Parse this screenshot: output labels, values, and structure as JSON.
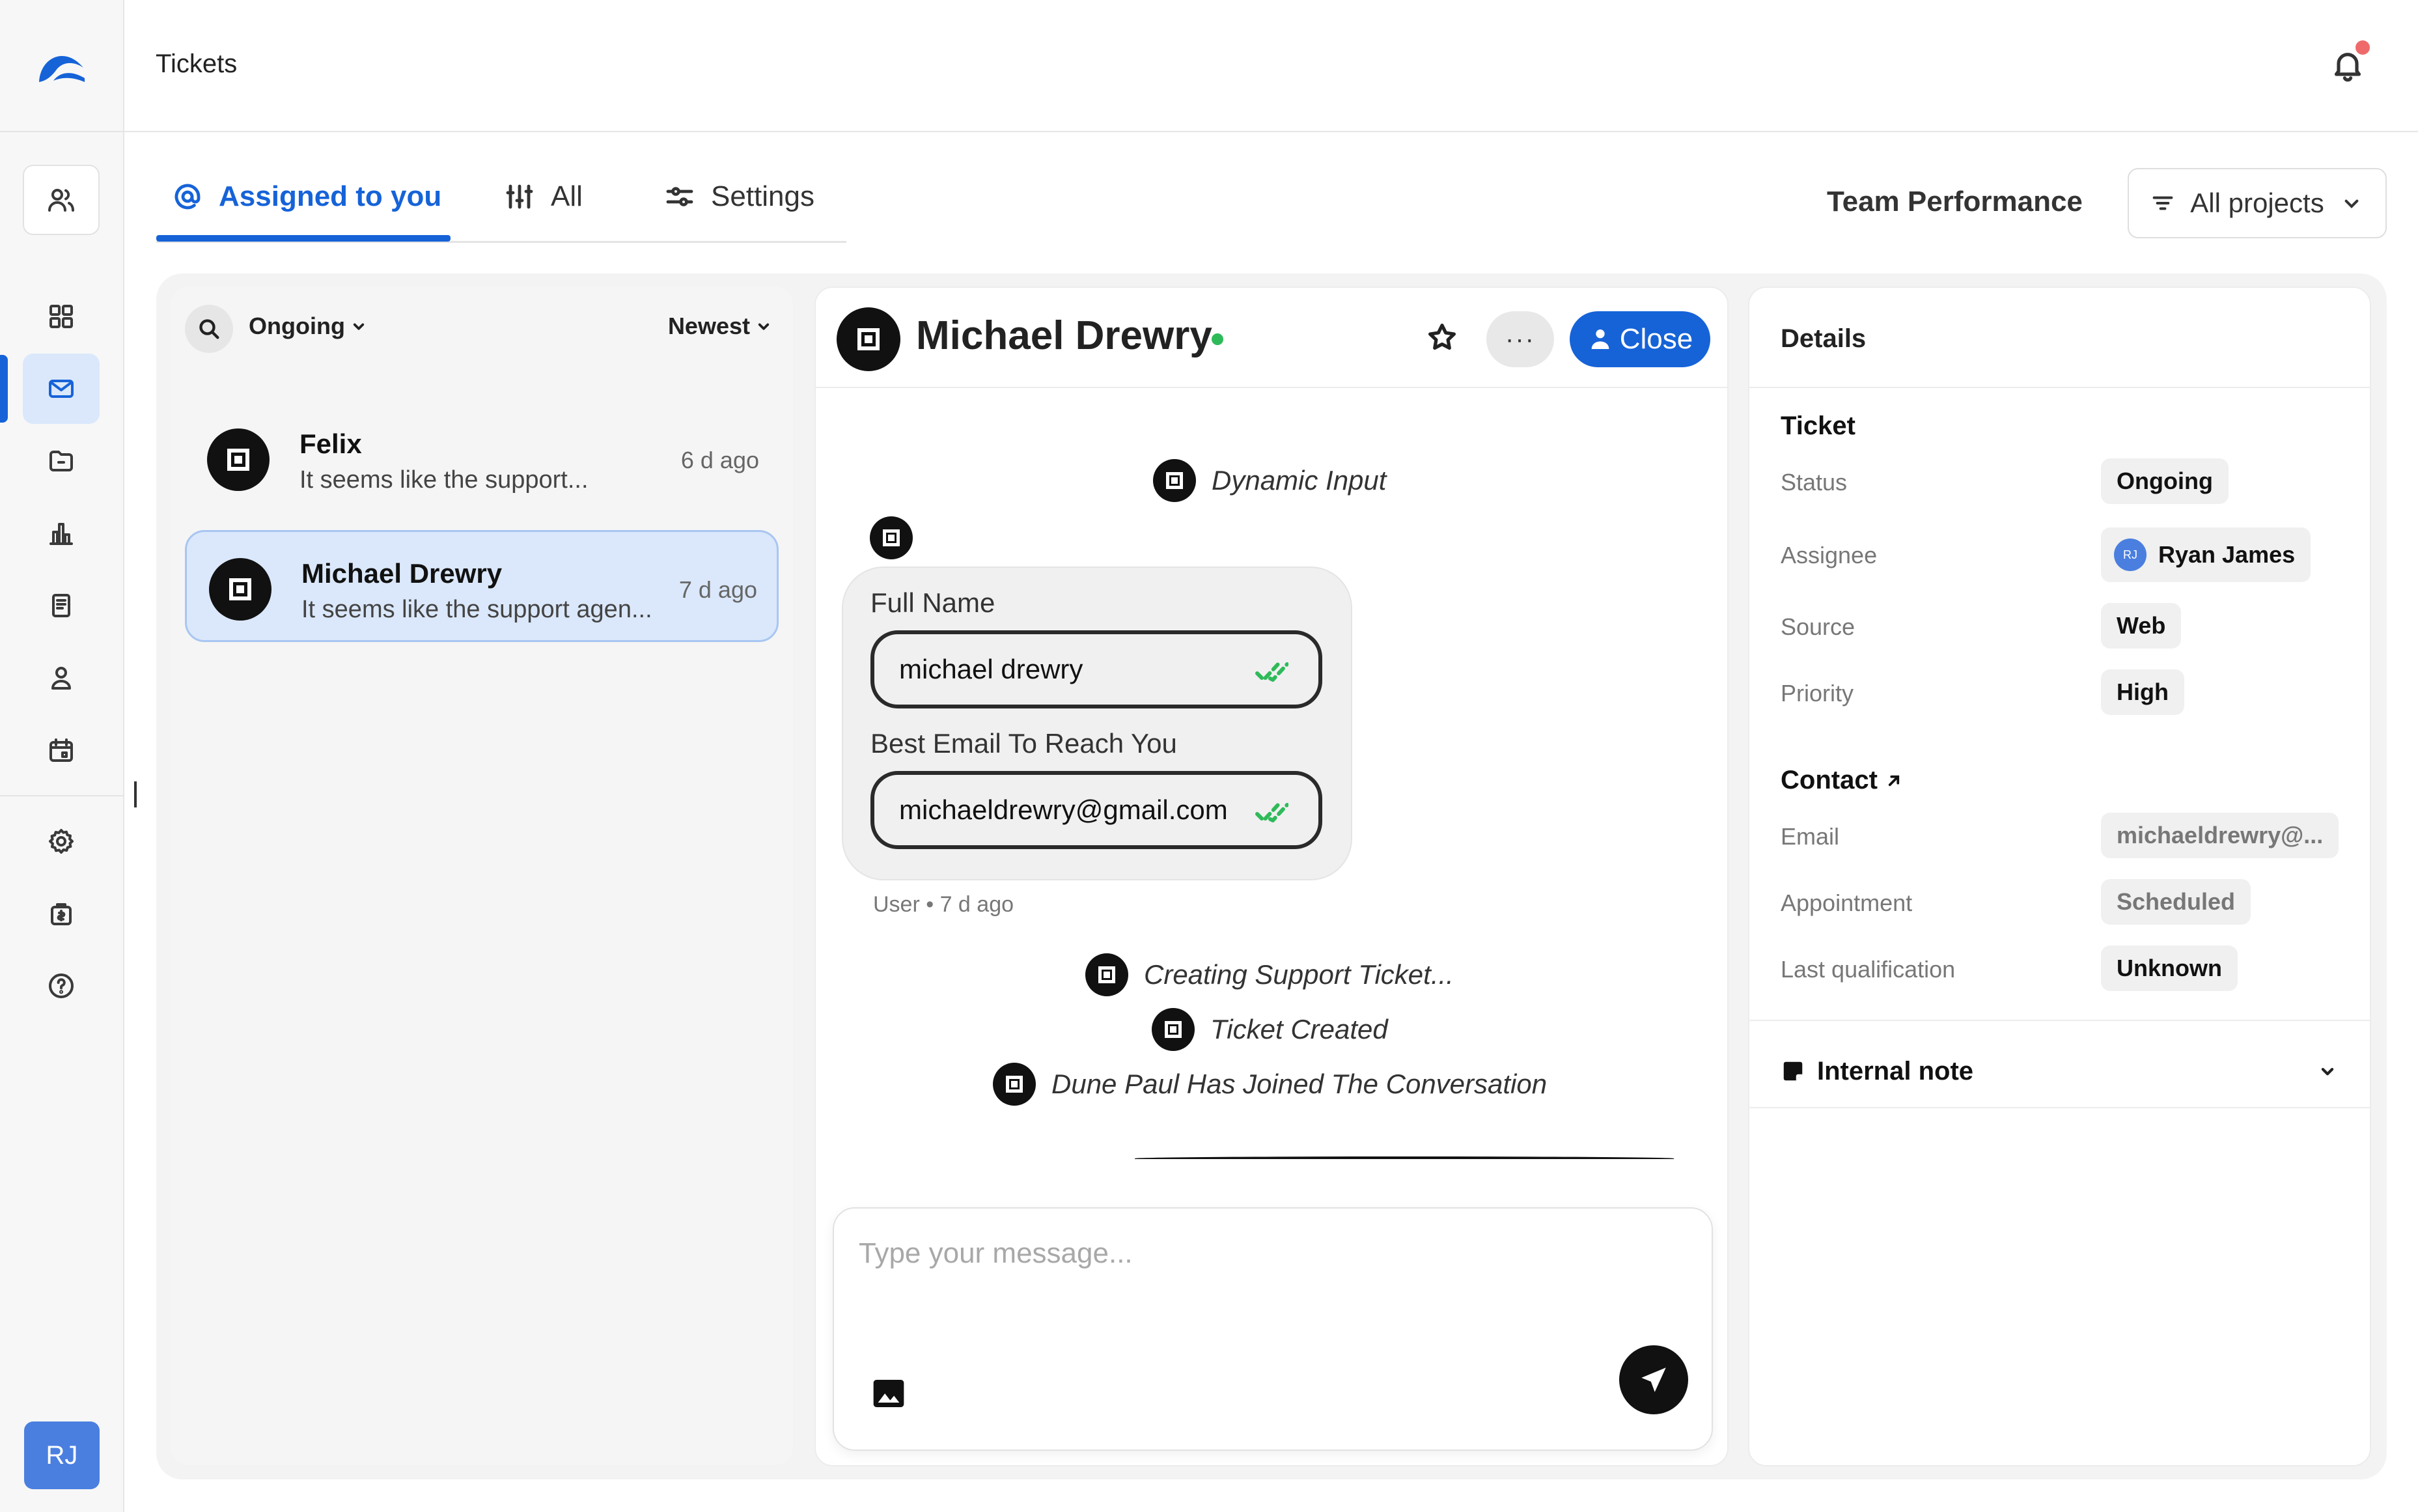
{
  "header": {
    "title": "Tickets"
  },
  "tabs": [
    {
      "label": "Assigned to you",
      "icon": "at-icon"
    },
    {
      "label": "All",
      "icon": "sliders-icon"
    },
    {
      "label": "Settings",
      "icon": "settings-sliders-icon"
    }
  ],
  "team_performance": "Team Performance",
  "project_filter": "All projects",
  "sidebar": {
    "avatar_initials": "RJ"
  },
  "list": {
    "status_filter": "Ongoing",
    "sort": "Newest",
    "conversations": [
      {
        "name": "Felix",
        "preview": "It seems like the support...",
        "time": "6 d ago"
      },
      {
        "name": "Michael Drewry",
        "preview": "It seems like the support agen...",
        "time": "7 d ago"
      }
    ]
  },
  "chat": {
    "contact_name": "Michael Drewry",
    "close_label": "Close",
    "events_top": "Dynamic Input",
    "form": {
      "fields": [
        {
          "label": "Full Name",
          "value": "michael drewry"
        },
        {
          "label": "Best Email To Reach You",
          "value": "michaeldrewry@gmail.com"
        }
      ]
    },
    "message_meta": "User • 7 d ago",
    "events": [
      "Creating Support Ticket...",
      "Ticket Created",
      "Dune Paul Has Joined The Conversation"
    ],
    "composer_placeholder": "Type your message..."
  },
  "details": {
    "title": "Details",
    "ticket": {
      "title": "Ticket",
      "rows": [
        {
          "label": "Status",
          "value": "Ongoing"
        },
        {
          "label": "Assignee",
          "value": "Ryan James",
          "initials": "RJ"
        },
        {
          "label": "Source",
          "value": "Web"
        },
        {
          "label": "Priority",
          "value": "High"
        }
      ]
    },
    "contact": {
      "title": "Contact",
      "rows": [
        {
          "label": "Email",
          "value": "michaeldrewry@..."
        },
        {
          "label": "Appointment",
          "value": "Scheduled"
        },
        {
          "label": "Last qualification",
          "value": "Unknown"
        }
      ]
    },
    "internal_note": "Internal note"
  },
  "colors": {
    "accent": "#1663d8",
    "active_bg": "#dbe8fb",
    "online": "#2fba5a",
    "notification": "#ef6a6a"
  }
}
